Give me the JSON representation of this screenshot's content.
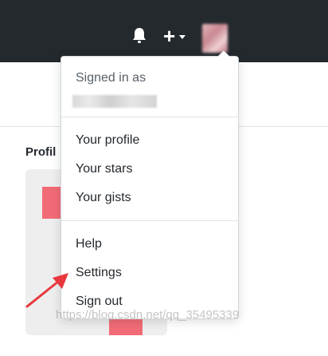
{
  "menu": {
    "signed_in_as": "Signed in as",
    "items_group_1": [
      "Your profile",
      "Your stars",
      "Your gists"
    ],
    "items_group_2": [
      "Help",
      "Settings",
      "Sign out"
    ]
  },
  "page": {
    "profile_label": "Profil"
  },
  "watermark": "https://blog.csdn.net/qq_35495339",
  "colors": {
    "header_bg": "#24292e",
    "identicon": "#f16b76",
    "arrow": "#e8383d"
  },
  "icons": {
    "notifications": "bell-icon",
    "create_new": "plus-icon"
  }
}
